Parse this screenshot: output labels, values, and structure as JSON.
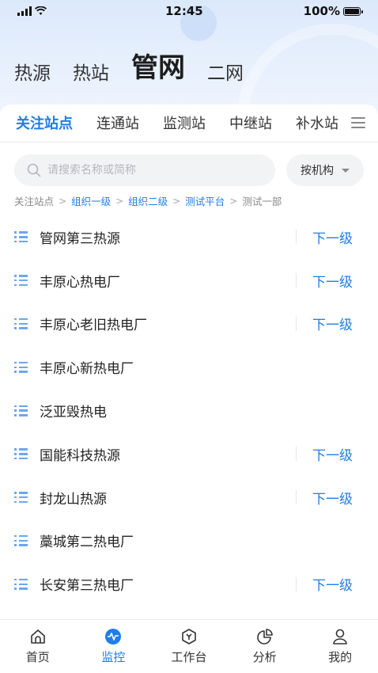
{
  "status_bar": {
    "time": "12:45",
    "battery": "100%"
  },
  "categories": [
    {
      "label": "热源",
      "active": false
    },
    {
      "label": "热站",
      "active": false
    },
    {
      "label": "管网",
      "active": true
    },
    {
      "label": "二网",
      "active": false
    }
  ],
  "sub_tabs": [
    {
      "label": "关注站点",
      "active": true
    },
    {
      "label": "连通站",
      "active": false
    },
    {
      "label": "监测站",
      "active": false
    },
    {
      "label": "中继站",
      "active": false
    },
    {
      "label": "补水站",
      "active": false
    }
  ],
  "search": {
    "placeholder": "请搜索名称或简称",
    "value": ""
  },
  "org_filter": {
    "label": "按机构"
  },
  "breadcrumb": [
    {
      "label": "关注站点",
      "link": false
    },
    {
      "label": "组织一级",
      "link": true
    },
    {
      "label": "组织二级",
      "link": true
    },
    {
      "label": "测试平台",
      "link": true
    },
    {
      "label": "测试一部",
      "link": false
    }
  ],
  "next_level_label": "下一级",
  "stations": [
    {
      "name": "管网第三热源",
      "has_next": true
    },
    {
      "name": "丰原心热电厂",
      "has_next": true
    },
    {
      "name": "丰原心老旧热电厂",
      "has_next": true
    },
    {
      "name": "丰原心新热电厂",
      "has_next": false
    },
    {
      "name": "泛亚毁热电",
      "has_next": false
    },
    {
      "name": "国能科技热源",
      "has_next": true
    },
    {
      "name": "封龙山热源",
      "has_next": true
    },
    {
      "name": "藁城第二热电厂",
      "has_next": false
    },
    {
      "name": "长安第三热电厂",
      "has_next": true
    }
  ],
  "bottom_nav": [
    {
      "label": "首页",
      "icon": "home-icon",
      "active": false
    },
    {
      "label": "监控",
      "icon": "monitor-icon",
      "active": true
    },
    {
      "label": "工作台",
      "icon": "workbench-icon",
      "active": false
    },
    {
      "label": "分析",
      "icon": "analysis-icon",
      "active": false
    },
    {
      "label": "我的",
      "icon": "profile-icon",
      "active": false
    }
  ],
  "colors": {
    "accent": "#1f7ee8",
    "list_icon": "#6ca7ee",
    "header_bg": "#dce9fb"
  }
}
